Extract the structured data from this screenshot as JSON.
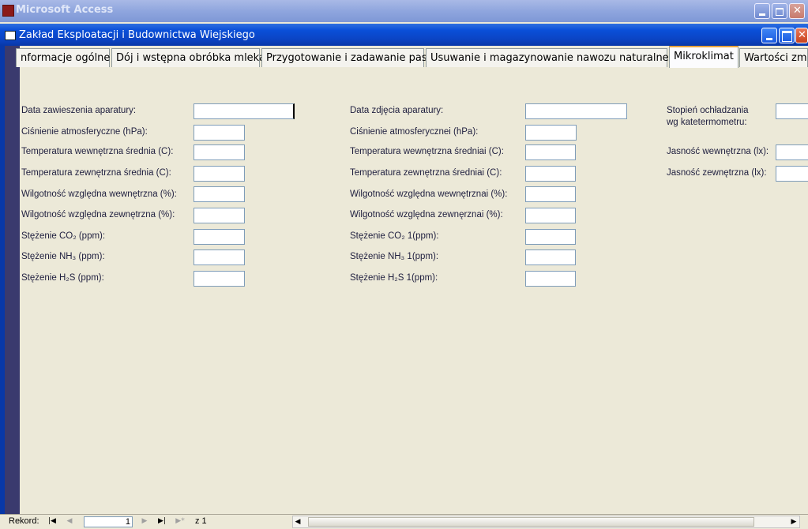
{
  "app": {
    "title": "Microsoft Access",
    "icon": "access-key-icon",
    "buttons": {
      "minimize": "minimize-icon",
      "restore": "restore-icon",
      "close": "close-icon"
    }
  },
  "form": {
    "title": "Zakład Eksploatacji i Budownictwa Wiejskiego",
    "icon": "form-icon",
    "tabs": [
      {
        "label": "nformacje ogólne",
        "active": false
      },
      {
        "label": "Dój i wstępna obróbka mleka",
        "active": false
      },
      {
        "label": "Przygotowanie i zadawanie pasz",
        "active": false
      },
      {
        "label": "Usuwanie i magazynowanie nawozu naturalnego",
        "active": false
      },
      {
        "label": "Mikroklimat",
        "active": true
      },
      {
        "label": "Wartości zm",
        "active": false
      }
    ],
    "fields_col1": [
      {
        "label": "Data zawieszenia aparatury:",
        "value": ""
      },
      {
        "label": "Ciśnienie atmosferyczne (hPa):",
        "value": ""
      },
      {
        "label": "Temperatura wewnętrzna średnia (C):",
        "value": ""
      },
      {
        "label": "Temperatura zewnętrzna średnia (C):",
        "value": ""
      },
      {
        "label": "Wilgotność względna wewnętrzna (%):",
        "value": ""
      },
      {
        "label": "Wilgotność względna zewnętrzna (%):",
        "value": ""
      },
      {
        "label": "Stężenie CO₂ (ppm):",
        "value": ""
      },
      {
        "label": "Stężenie NH₃ (ppm):",
        "value": ""
      },
      {
        "label": "Stężenie H₂S (ppm):",
        "value": ""
      }
    ],
    "fields_col2": [
      {
        "label": "Data zdjęcia aparatury:",
        "value": ""
      },
      {
        "label": "Ciśnienie atmosferycznei (hPa):",
        "value": ""
      },
      {
        "label": "Temperatura wewnętrzna średniai (C):",
        "value": ""
      },
      {
        "label": "Temperatura zewnętrzna średniai (C):",
        "value": ""
      },
      {
        "label": "Wilgotność względna wewnętrznai (%):",
        "value": ""
      },
      {
        "label": "Wilgotność względna zewnęrznai (%):",
        "value": ""
      },
      {
        "label": "Stężenie CO₂ 1(ppm):",
        "value": ""
      },
      {
        "label": "Stężenie NH₃ 1(ppm):",
        "value": ""
      },
      {
        "label": "Stężenie H₂S 1(ppm):",
        "value": ""
      }
    ],
    "fields_col3": [
      {
        "label_line1": "Stopień ochładzania",
        "label_line2": "wg katetermometru:",
        "value": ""
      },
      {
        "label": "Jasność wewnętrzna (lx):",
        "value": ""
      },
      {
        "label": "Jasność zewnętrzna (lx):",
        "value": ""
      }
    ]
  },
  "nav": {
    "label": "Rekord:",
    "current": "1",
    "of_label": "z  1",
    "buttons": [
      "first-record-icon",
      "prev-record-icon",
      "next-record-icon",
      "last-record-icon",
      "new-record-icon"
    ]
  },
  "colors": {
    "titlebar_active": "#0b44c4",
    "tab_active_accent": "#e8a33c",
    "form_bg": "#ece9d8"
  }
}
